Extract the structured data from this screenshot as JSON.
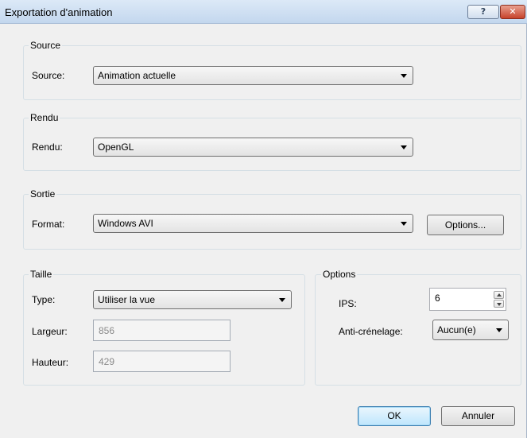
{
  "window": {
    "title": "Exportation d'animation",
    "help_glyph": "?",
    "close_glyph": "✕"
  },
  "source": {
    "group_label": "Source",
    "label": "Source:",
    "value": "Animation actuelle"
  },
  "rendu": {
    "group_label": "Rendu",
    "label": "Rendu:",
    "value": "OpenGL"
  },
  "sortie": {
    "group_label": "Sortie",
    "label": "Format:",
    "value": "Windows AVI",
    "options_button": "Options..."
  },
  "taille": {
    "group_label": "Taille",
    "type_label": "Type:",
    "type_value": "Utiliser la vue",
    "largeur_label": "Largeur:",
    "largeur_value": "856",
    "hauteur_label": "Hauteur:",
    "hauteur_value": "429"
  },
  "options": {
    "group_label": "Options",
    "ips_label": "IPS:",
    "ips_value": "6",
    "aa_label": "Anti-crénelage:",
    "aa_value": "Aucun(e)"
  },
  "footer": {
    "ok_label": "OK",
    "cancel_label": "Annuler"
  },
  "colors": {
    "titlebar": "#c3d7ee",
    "dialog_bg": "#f0f0f0",
    "group_border": "#d5dfe5",
    "close_button": "#c7432b",
    "default_button": "#bee6fd"
  },
  "icons": {
    "help": "help-icon",
    "close": "close-icon",
    "dropdown": "chevron-down-icon",
    "spin_up": "spin-up-icon",
    "spin_down": "spin-down-icon"
  }
}
